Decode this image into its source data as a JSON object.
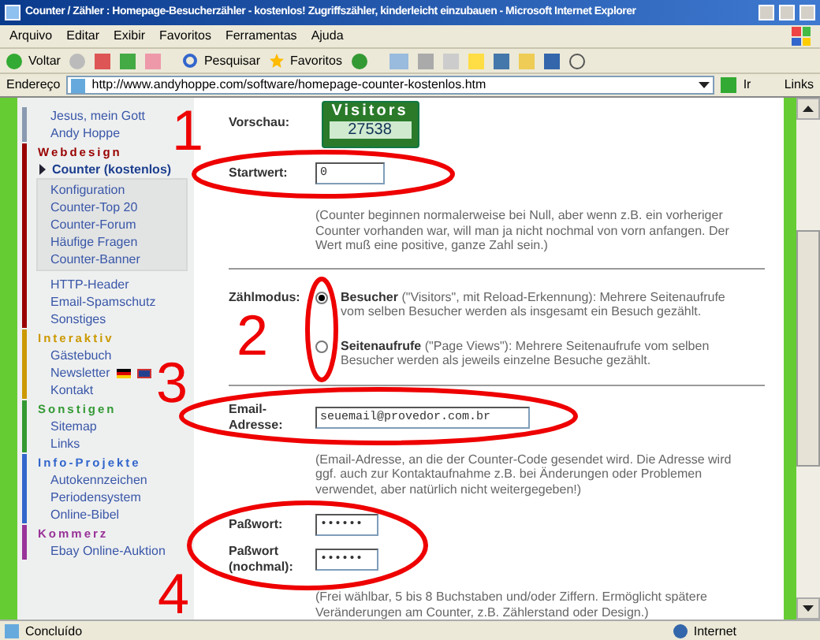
{
  "window": {
    "title": "Counter / Zähler : Homepage-Besucherzähler - kostenlos! Zugriffszähler, kinderleicht einzubauen - Microsoft Internet Explorer"
  },
  "menu": [
    "Arquivo",
    "Editar",
    "Exibir",
    "Favoritos",
    "Ferramentas",
    "Ajuda"
  ],
  "toolbar": {
    "back": "Voltar",
    "search": "Pesquisar",
    "favorites": "Favoritos"
  },
  "address_bar": {
    "label": "Endereço",
    "url": "http://www.andyhoppe.com/software/homepage-counter-kostenlos.htm",
    "go": "Ir",
    "links": "Links"
  },
  "sidebar": {
    "sections": [
      {
        "color": "#8a9ab0",
        "items": [
          {
            "label": "Jesus, mein Gott",
            "kind": "link",
            "selected": false
          },
          {
            "label": "Andy Hoppe",
            "kind": "link",
            "selected": false
          }
        ]
      },
      {
        "title": "Webdesign",
        "color": "#990000",
        "items": [
          {
            "label": "Counter (kostenlos)",
            "kind": "link",
            "selected": true,
            "children": [
              {
                "label": "Konfiguration"
              },
              {
                "label": "Counter-Top 20"
              },
              {
                "label": "Counter-Forum"
              },
              {
                "label": "Häufige Fragen"
              },
              {
                "label": "Counter-Banner"
              }
            ]
          },
          {
            "label": "HTTP-Header",
            "kind": "link",
            "selected": false
          },
          {
            "label": "Email-Spamschutz",
            "kind": "link",
            "selected": false
          },
          {
            "label": "Sonstiges",
            "kind": "link",
            "selected": false
          }
        ]
      },
      {
        "title": "Interaktiv",
        "color": "#cc9900",
        "items": [
          {
            "label": "Gästebuch",
            "kind": "link",
            "selected": false
          },
          {
            "label": "Newsletter",
            "kind": "flags",
            "selected": false
          },
          {
            "label": "Kontakt",
            "kind": "link",
            "selected": false
          }
        ]
      },
      {
        "title": "Sonstigen",
        "color": "#339933",
        "items": [
          {
            "label": "Sitemap",
            "kind": "link",
            "selected": false
          },
          {
            "label": "Links",
            "kind": "link",
            "selected": false
          }
        ]
      },
      {
        "title": "Info-Projekte",
        "color": "#3366cc",
        "items": [
          {
            "label": "Autokennzeichen",
            "kind": "link",
            "selected": false
          },
          {
            "label": "Periodensystem",
            "kind": "link",
            "selected": false
          },
          {
            "label": "Online-Bibel",
            "kind": "link",
            "selected": false
          }
        ]
      },
      {
        "title": "Kommerz",
        "color": "#993399",
        "items": [
          {
            "label": "Ebay Online-Auktion",
            "kind": "link",
            "selected": false
          }
        ]
      }
    ]
  },
  "form": {
    "preview": {
      "label": "Vorschau:",
      "badge_title": "Visitors",
      "badge_count": "27538"
    },
    "start": {
      "label": "Startwert:",
      "value": "0",
      "note": "(Counter beginnen normalerweise bei Null, aber wenn z.B. ein vorheriger Counter vorhanden war, will man ja nicht nochmal von vorn anfangen. Der Wert muß eine positive, ganze Zahl sein.)"
    },
    "mode": {
      "label": "Zählmodus:",
      "options": [
        {
          "title": "Besucher",
          "text": " (\"Visitors\", mit Reload-Erkennung): Mehrere Seitenaufrufe vom selben Besucher werden als insgesamt ein Besuch gezählt.",
          "selected": true
        },
        {
          "title": "Seitenaufrufe",
          "text": " (\"Page Views\"): Mehrere Seitenaufrufe vom selben Besucher werden als jeweils einzelne Besuche gezählt.",
          "selected": false
        }
      ]
    },
    "email": {
      "label": "Email-Adresse:",
      "value": "seuemail@provedor.com.br",
      "note": "(Email-Adresse, an die der Counter-Code gesendet wird. Die Adresse wird ggf. auch zur Kontaktaufnahme z.B. bei Änderungen oder Problemen verwendet, aber natürlich nicht weitergegeben!)"
    },
    "password": {
      "label": "Paßwort:",
      "value": "••••••"
    },
    "password_repeat": {
      "label": "Paßwort (nochmal):",
      "value": "••••••",
      "note": "(Frei wählbar, 5 bis 8 Buchstaben und/oder Ziffern. Ermöglicht spätere Veränderungen am Counter, z.B. Zählerstand oder Design.)"
    }
  },
  "annotations": [
    "1",
    "2",
    "3",
    "4"
  ],
  "status_bar": {
    "text": "Concluído",
    "zone": "Internet"
  }
}
